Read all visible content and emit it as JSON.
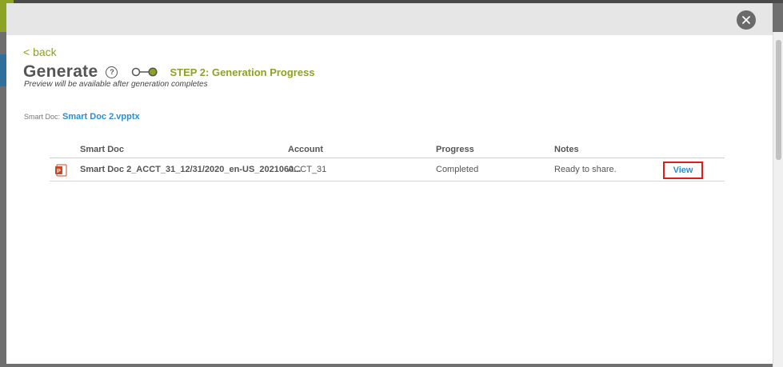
{
  "dialog": {
    "back_label": "< back",
    "title": "Generate",
    "help_icon_glyph": "?",
    "step_label": "STEP 2: Generation Progress",
    "subtitle": "Preview will be available after generation completes",
    "smart_doc_prefix": "Smart Doc:",
    "smart_doc_name": "Smart Doc 2.vpptx"
  },
  "table": {
    "columns": [
      "Smart Doc",
      "Account",
      "Progress",
      "Notes"
    ],
    "rows": [
      {
        "file_icon": "powerpoint-file-icon",
        "smart_doc": "Smart Doc 2_ACCT_31_12/31/2020_en-US_2021060...",
        "account": "ACCT_31",
        "progress": "Completed",
        "notes": "Ready to share.",
        "action_label": "View"
      }
    ]
  },
  "colors": {
    "accent_green": "#8da323",
    "link_blue": "#2a8fd1",
    "highlight_red": "#e21b1b"
  }
}
